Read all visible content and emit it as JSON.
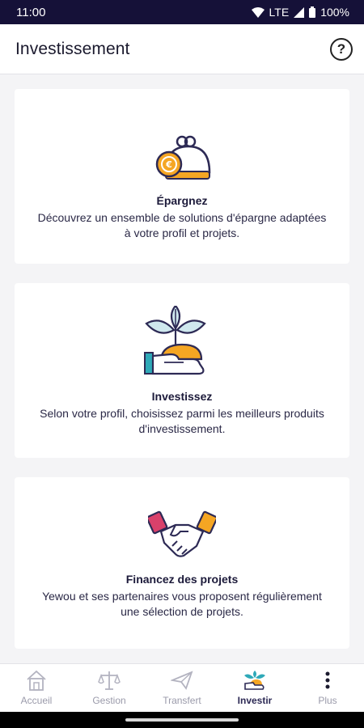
{
  "status": {
    "time": "11:00",
    "network": "LTE",
    "battery": "100%"
  },
  "header": {
    "title": "Investissement",
    "help_icon": "help-circle-icon",
    "help_glyph": "?"
  },
  "cards": [
    {
      "icon": "coin-purse-icon",
      "title": "Épargnez",
      "description": "Découvrez un ensemble de solutions d'épargne adaptées à votre profil et projets."
    },
    {
      "icon": "plant-hand-icon",
      "title": "Investissez",
      "description": "Selon votre profil, choisissez parmi les meilleurs produits d'investissement."
    },
    {
      "icon": "handshake-icon",
      "title": "Financez des projets",
      "description": "Yewou et ses partenaires vous proposent régulièrement une sélection de projets."
    }
  ],
  "nav": [
    {
      "label": "Accueil",
      "icon": "home-icon"
    },
    {
      "label": "Gestion",
      "icon": "balance-scale-icon"
    },
    {
      "label": "Transfert",
      "icon": "paper-plane-icon"
    },
    {
      "label": "Investir",
      "icon": "invest-icon",
      "active": true
    },
    {
      "label": "Plus",
      "icon": "more-vertical-icon"
    }
  ],
  "colors": {
    "status_bar": "#151138",
    "accent_orange": "#f5a623",
    "accent_teal": "#2fa9b8",
    "accent_pink": "#d9416b",
    "text_dark": "#1c1a3a"
  }
}
